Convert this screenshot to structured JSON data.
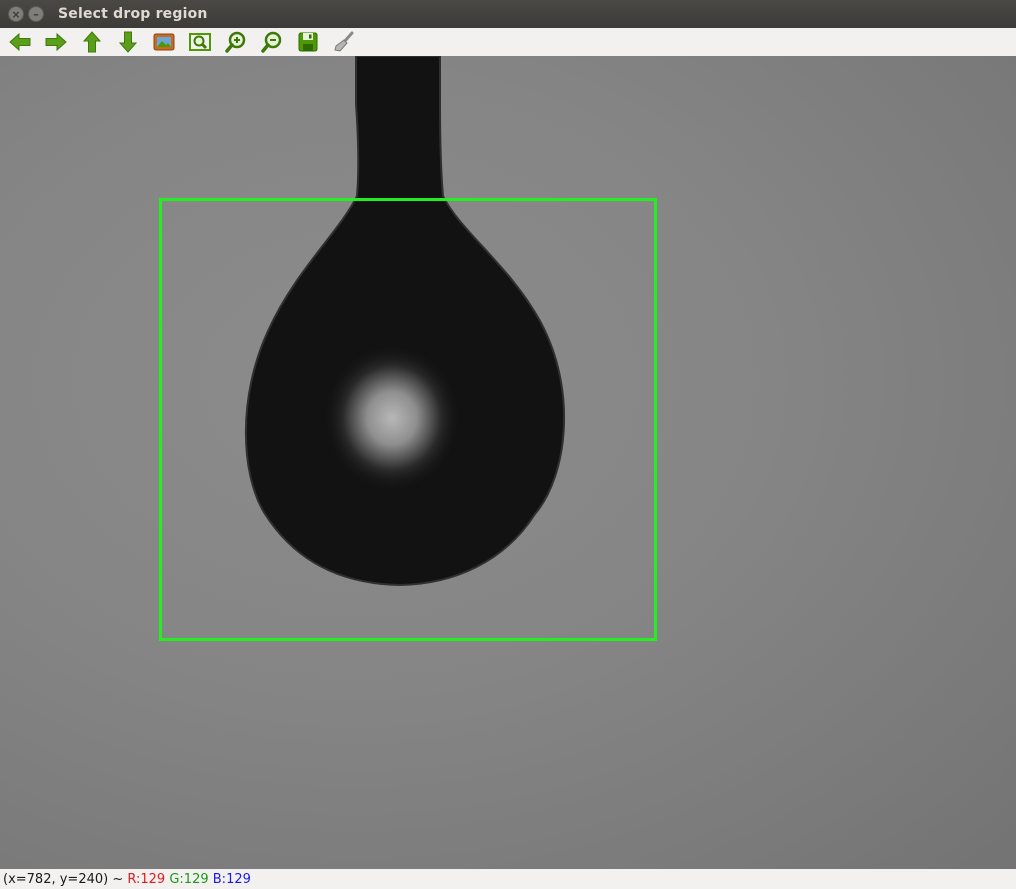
{
  "window": {
    "title": "Select drop region",
    "close_glyph": "×",
    "min_glyph": "–"
  },
  "toolbar": {
    "items": [
      {
        "name": "pan-left",
        "icon": "arrow-left-icon"
      },
      {
        "name": "pan-right",
        "icon": "arrow-right-icon"
      },
      {
        "name": "pan-up",
        "icon": "arrow-up-icon"
      },
      {
        "name": "pan-down",
        "icon": "arrow-down-icon"
      },
      {
        "name": "zoom-original",
        "icon": "image-icon"
      },
      {
        "name": "zoom-fit",
        "icon": "zoom-fit-icon"
      },
      {
        "name": "zoom-in",
        "icon": "zoom-in-icon"
      },
      {
        "name": "zoom-out",
        "icon": "zoom-out-icon"
      },
      {
        "name": "save-image",
        "icon": "save-icon"
      },
      {
        "name": "properties",
        "icon": "brush-icon"
      }
    ],
    "icon_color": "#4e9a06"
  },
  "roi": {
    "color": "#22ee22"
  },
  "status": {
    "coords": "(x=782, y=240) ~ ",
    "r": "R:129",
    "g": "G:129",
    "b": "B:129"
  }
}
